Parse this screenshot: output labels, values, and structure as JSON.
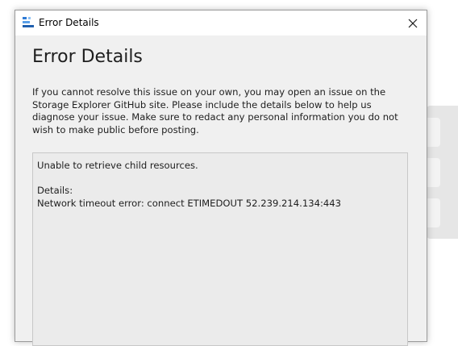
{
  "window": {
    "title": "Error Details",
    "icon": "storage-explorer-icon",
    "close_icon": "close-icon"
  },
  "dialog": {
    "heading": "Error Details",
    "description": "If you cannot resolve this issue on your own, you may open an issue on the Storage Explorer GitHub site. Please include the details below to help us diagnose your issue. Make sure to redact any personal information you do not wish to make public before posting."
  },
  "details": {
    "summary": "Unable to retrieve child resources.",
    "label": "Details:",
    "message": "Network timeout error: connect ETIMEDOUT 52.239.214.134:443"
  },
  "colors": {
    "dialog_bg": "#f0f0f0",
    "titlebar_bg": "#ffffff",
    "details_bg": "#ebebeb",
    "icon_blue": "#2e7bd6"
  }
}
